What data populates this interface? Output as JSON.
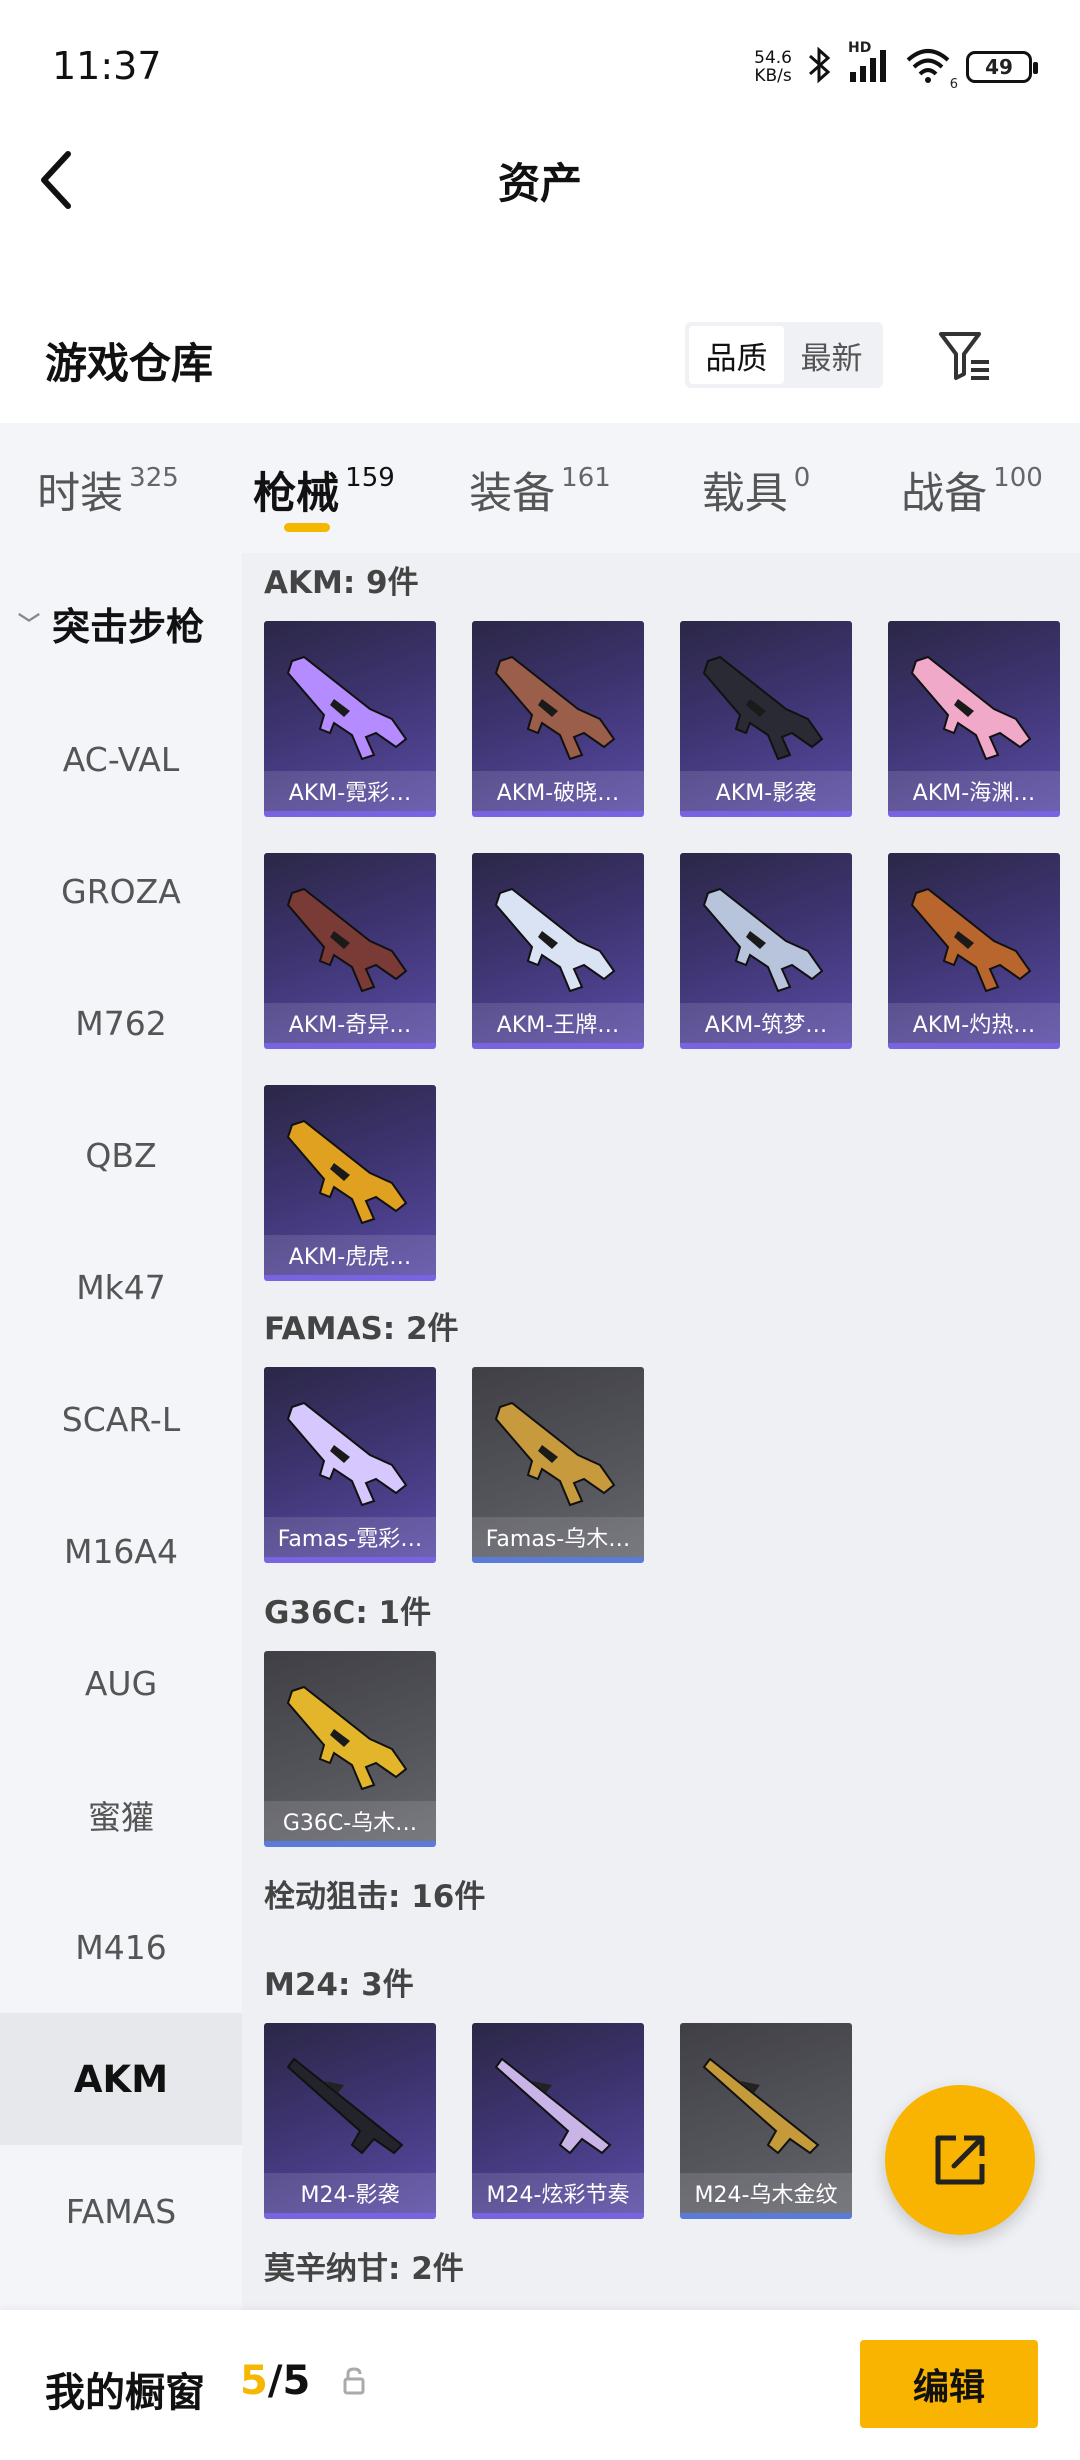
{
  "status_bar": {
    "time": "11:37",
    "net_speed_value": "54.6",
    "net_speed_unit": "KB/s",
    "wifi_badge": "6",
    "signal_badge": "HD",
    "battery": "49"
  },
  "header": {
    "title": "资产"
  },
  "warehouse": {
    "title": "游戏仓库",
    "sort_options": [
      "品质",
      "最新"
    ],
    "active_sort": "品质"
  },
  "categories": [
    {
      "label": "时装",
      "count": "325"
    },
    {
      "label": "枪械",
      "count": "159"
    },
    {
      "label": "装备",
      "count": "161"
    },
    {
      "label": "载具",
      "count": "0"
    },
    {
      "label": "战备",
      "count": "100"
    }
  ],
  "sidebar": {
    "section": "突击步枪",
    "items": [
      "AC-VAL",
      "GROZA",
      "M762",
      "QBZ",
      "Mk47",
      "SCAR-L",
      "M16A4",
      "AUG",
      "蜜獾",
      "M416",
      "AKM",
      "FAMAS"
    ],
    "active": "AKM"
  },
  "groups": [
    {
      "label": "AKM: 9件",
      "items": [
        {
          "name": "AKM-霓彩…",
          "style": "purple",
          "color": "#b58cff"
        },
        {
          "name": "AKM-破晓…",
          "style": "purple",
          "color": "#9a5e4a"
        },
        {
          "name": "AKM-影袭",
          "style": "purple",
          "color": "#2a2a34"
        },
        {
          "name": "AKM-海渊…",
          "style": "purple",
          "color": "#f0a9c8"
        },
        {
          "name": "AKM-奇异…",
          "style": "purple",
          "color": "#7a3a36"
        },
        {
          "name": "AKM-王牌…",
          "style": "purple",
          "color": "#d9e3f4"
        },
        {
          "name": "AKM-筑梦…",
          "style": "purple",
          "color": "#b8c4dc"
        },
        {
          "name": "AKM-灼热…",
          "style": "purple",
          "color": "#b8652e"
        },
        {
          "name": "AKM-虎虎…",
          "style": "purple",
          "color": "#e0a020"
        }
      ]
    },
    {
      "label": "FAMAS: 2件",
      "items": [
        {
          "name": "Famas-霓彩…",
          "style": "purple",
          "color": "#d6c8ff"
        },
        {
          "name": "Famas-乌木…",
          "style": "gray",
          "color": "#c79a3e"
        }
      ]
    },
    {
      "label": "G36C: 1件",
      "items": [
        {
          "name": "G36C-乌木…",
          "style": "gray",
          "color": "#e3b52a"
        }
      ]
    },
    {
      "label": "栓动狙击: 16件",
      "items": []
    },
    {
      "label": "M24: 3件",
      "items": [
        {
          "name": "M24-影袭",
          "style": "purple",
          "color": "#23232c"
        },
        {
          "name": "M24-炫彩节奏",
          "style": "purple",
          "color": "#c9b4e8"
        },
        {
          "name": "M24-乌木金纹",
          "style": "gray",
          "color": "#c49a3a"
        }
      ]
    },
    {
      "label": "莫辛纳甘: 2件",
      "items": []
    }
  ],
  "bottom_bar": {
    "title": "我的橱窗",
    "current": "5",
    "separator": "/",
    "total": "5",
    "edit_label": "编辑"
  },
  "colors": {
    "accent": "#f8b400",
    "card_purple": "#3d3470",
    "card_gray": "#55555c"
  }
}
